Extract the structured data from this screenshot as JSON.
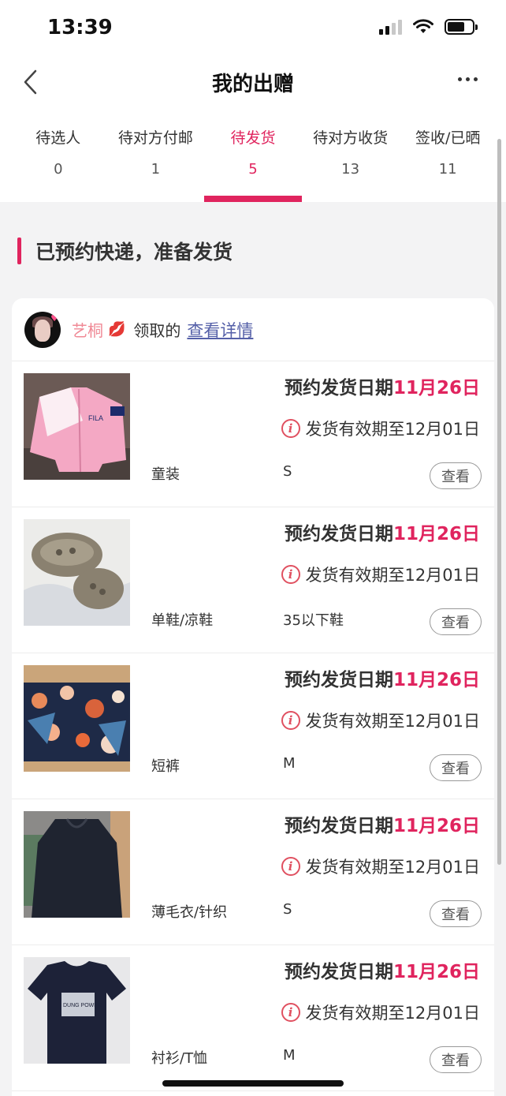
{
  "status_bar": {
    "time": "13:39"
  },
  "nav": {
    "title": "我的出赠"
  },
  "tabs": [
    {
      "label": "待选人",
      "count": "0",
      "active": false
    },
    {
      "label": "待对方付邮",
      "count": "1",
      "active": false
    },
    {
      "label": "待发货",
      "count": "5",
      "active": true
    },
    {
      "label": "待对方收货",
      "count": "13",
      "active": false
    },
    {
      "label": "签收/已晒",
      "count": "11",
      "active": false
    }
  ],
  "section": {
    "title": "已预约快递，准备发货"
  },
  "giver": {
    "name": "艺桐",
    "emoji": "💋",
    "suffix": "领取的",
    "detail_link": "查看详情"
  },
  "labels": {
    "date_prefix": "预约发货日期",
    "valid_prefix": "发货有效期至",
    "view_button": "查看"
  },
  "items": [
    {
      "category": "童装",
      "size": "S",
      "ship_date": "11月26日",
      "valid_until": "12月01日"
    },
    {
      "category": "单鞋/凉鞋",
      "size": "35以下鞋",
      "ship_date": "11月26日",
      "valid_until": "12月01日"
    },
    {
      "category": "短裤",
      "size": "M",
      "ship_date": "11月26日",
      "valid_until": "12月01日"
    },
    {
      "category": "薄毛衣/针织",
      "size": "S",
      "ship_date": "11月26日",
      "valid_until": "12月01日"
    },
    {
      "category": "衬衫/T恤",
      "size": "M",
      "ship_date": "11月26日",
      "valid_until": "12月01日"
    }
  ],
  "colors": {
    "accent": "#e0245e",
    "link": "#5560a8",
    "background": "#f3f3f4"
  }
}
